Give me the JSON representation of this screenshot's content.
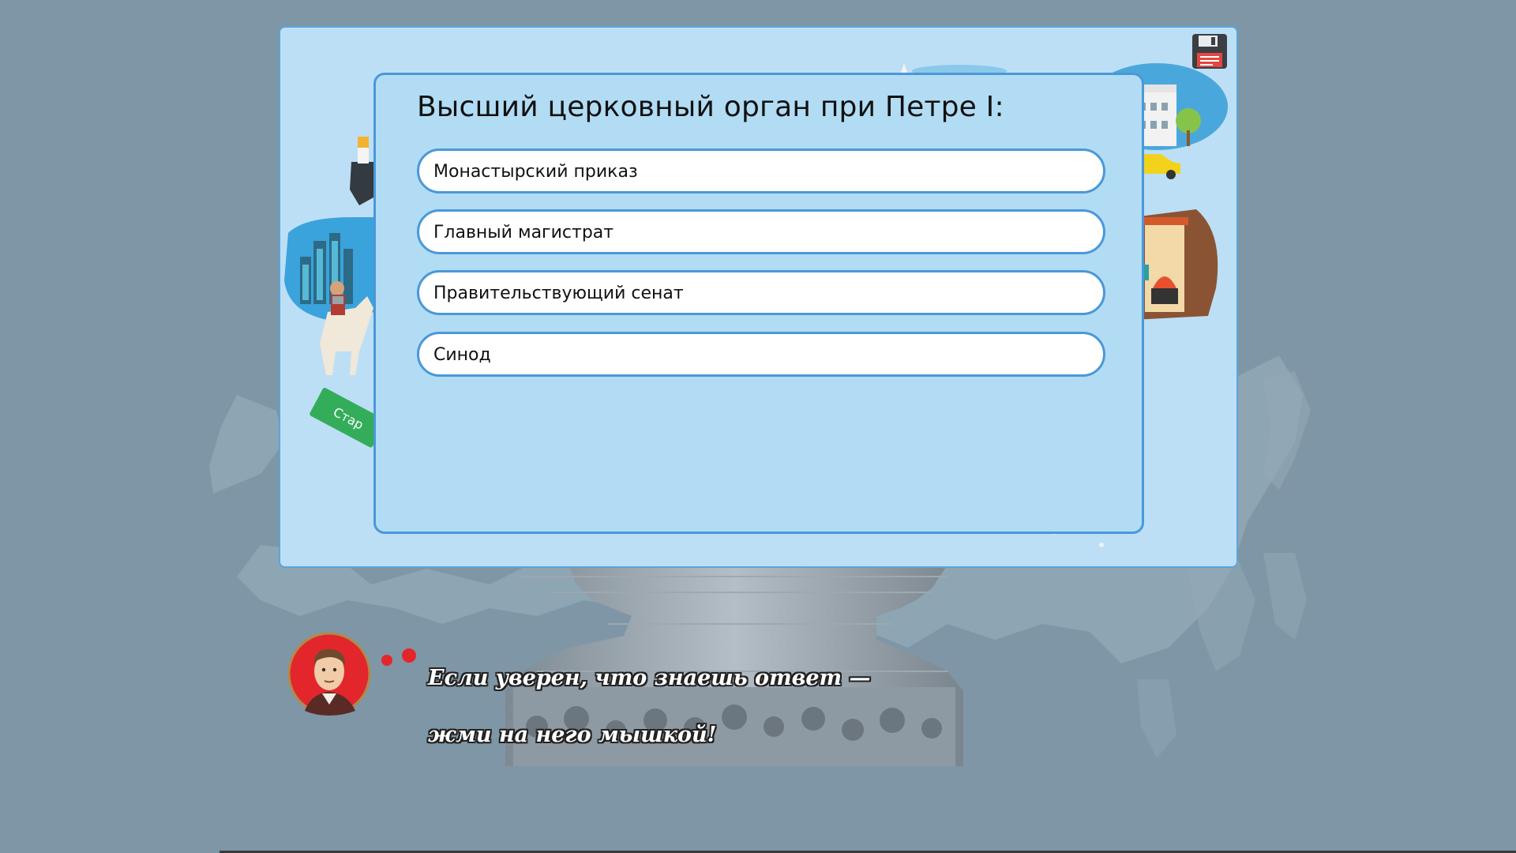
{
  "quiz": {
    "question": "Высший церковный орган при Петре I:",
    "answers": [
      {
        "label": "Монастырский приказ"
      },
      {
        "label": "Главный магистрат"
      },
      {
        "label": "Правительствующий сенат"
      },
      {
        "label": "Синод"
      }
    ]
  },
  "hint": {
    "line1": "Если уверен, что знаешь ответ —",
    "line2": "жми на него мышкой!"
  },
  "decor": {
    "sign_text": "Стар"
  },
  "colors": {
    "background": "#7f96a6",
    "panel": "#bddff6",
    "card": "#b1dcf4",
    "border": "#4a98d8",
    "answer_bg": "#ffffff"
  },
  "icons": {
    "save": "floppy-disk-icon",
    "avatar": "historian-portrait-icon"
  }
}
